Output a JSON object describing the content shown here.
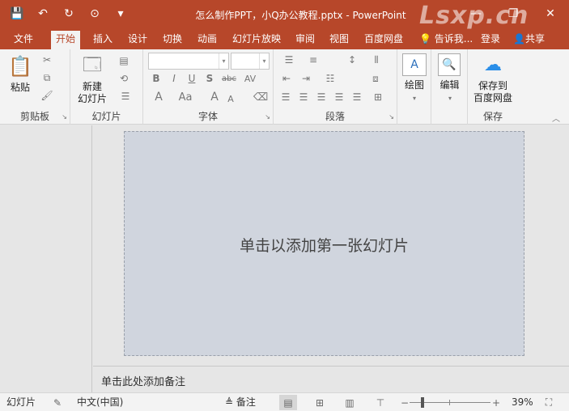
{
  "window": {
    "title": "怎么制作PPT，小Q办公教程.pptx - PowerPoint",
    "watermark": "Lsxp.cn",
    "minimize": "—",
    "restore": "❐",
    "close": "✕"
  },
  "qat": {
    "save": "💾",
    "undo": "↶",
    "redo": "↻",
    "present": "⊙",
    "customize": "▾"
  },
  "tabs": [
    "文件",
    "开始",
    "插入",
    "设计",
    "切换",
    "动画",
    "幻灯片放映",
    "审阅",
    "视图",
    "百度网盘"
  ],
  "active_tab": "开始",
  "tellme": "告诉我...",
  "login": "登录",
  "share": "共享",
  "ribbon": {
    "clipboard": {
      "label": "剪贴板",
      "paste": "粘贴"
    },
    "slides": {
      "label": "幻灯片",
      "new_slide_line1": "新建",
      "new_slide_line2": "幻灯片"
    },
    "font": {
      "label": "字体",
      "bold": "B",
      "italic": "I",
      "underline": "U",
      "shadow": "S",
      "strike": "abc",
      "spacing": "AV",
      "fontcolor": "A",
      "case": "Aa",
      "grow": "A",
      "shrink": "A"
    },
    "paragraph": {
      "label": "段落"
    },
    "drawing": {
      "label": "绘图"
    },
    "editing": {
      "label": "编辑"
    },
    "save": {
      "label": "保存",
      "btn_line1": "保存到",
      "btn_line2": "百度网盘"
    }
  },
  "slide": {
    "placeholder": "单击以添加第一张幻灯片"
  },
  "notes": {
    "placeholder": "单击此处添加备注"
  },
  "status": {
    "slide": "幻灯片",
    "language": "中文(中国)",
    "notes": "备注",
    "zoom": "39%"
  },
  "colors": {
    "accent": "#b7472a"
  }
}
